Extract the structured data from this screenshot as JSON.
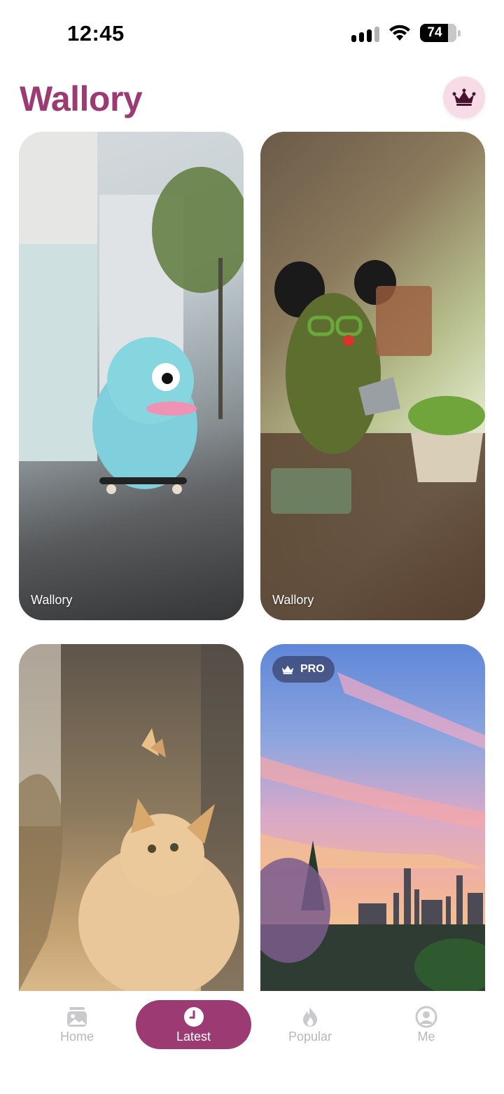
{
  "status_bar": {
    "time": "12:45",
    "battery_level": "74"
  },
  "header": {
    "title": "Wallory",
    "pro_button_icon": "crown-icon"
  },
  "wallpapers": [
    {
      "label": "Wallory",
      "pro": false,
      "description_icon": "image"
    },
    {
      "label": "Wallory",
      "pro": false,
      "description_icon": "image"
    },
    {
      "label": "",
      "pro": false,
      "description_icon": "image"
    },
    {
      "label": "",
      "pro": true,
      "badge_label": "PRO",
      "description_icon": "image"
    }
  ],
  "nav": {
    "items": [
      {
        "label": "Home",
        "icon": "gallery-icon",
        "active": false
      },
      {
        "label": "Latest",
        "icon": "clock-icon",
        "active": true
      },
      {
        "label": "Popular",
        "icon": "flame-icon",
        "active": false
      },
      {
        "label": "Me",
        "icon": "person-icon",
        "active": false
      }
    ]
  },
  "colors": {
    "accent": "#9b3a73",
    "pro_button_bg": "#f7dce8",
    "inactive_nav": "#b7b7bc"
  }
}
